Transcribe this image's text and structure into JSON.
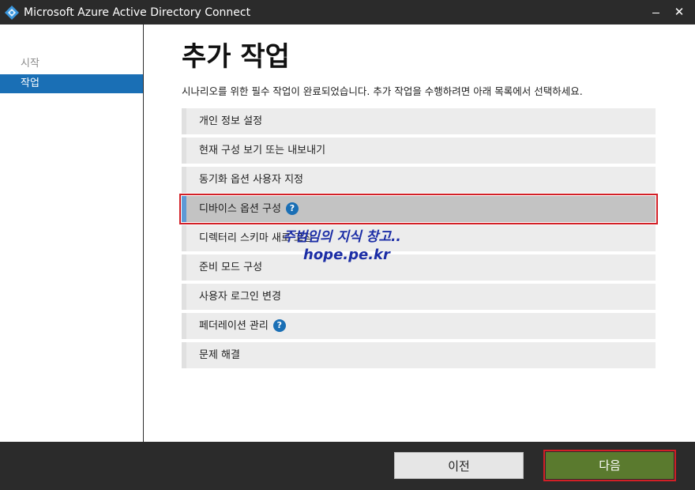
{
  "window": {
    "title": "Microsoft Azure Active Directory Connect",
    "minimize_icon": "minimize-icon",
    "close_label": "✕",
    "logo_icon": "azure-diamond-icon"
  },
  "sidebar": {
    "items": [
      {
        "label": "시작",
        "state": "visited"
      },
      {
        "label": "작업",
        "state": "active"
      }
    ]
  },
  "main": {
    "title": "추가 작업",
    "intro": "시나리오를 위한 필수 작업이 완료되었습니다. 추가 작업을 수행하려면 아래 목록에서 선택하세요.",
    "tasks": [
      {
        "label": "개인 정보 설정",
        "help": false,
        "selected": false
      },
      {
        "label": "현재 구성 보기 또는 내보내기",
        "help": false,
        "selected": false
      },
      {
        "label": "동기화 옵션 사용자 지정",
        "help": false,
        "selected": false
      },
      {
        "label": "디바이스 옵션 구성",
        "help": true,
        "selected": true
      },
      {
        "label": "디렉터리 스키마 새로 고침",
        "help": false,
        "selected": false
      },
      {
        "label": "준비 모드 구성",
        "help": false,
        "selected": false
      },
      {
        "label": "사용자 로그인 변경",
        "help": false,
        "selected": false
      },
      {
        "label": "페더레이션 관리",
        "help": true,
        "selected": false
      },
      {
        "label": "문제 해결",
        "help": false,
        "selected": false
      }
    ],
    "help_symbol": "?"
  },
  "watermark": {
    "line1": "주범임의 지식 창고..",
    "line2": "hope.pe.kr"
  },
  "footer": {
    "previous_label": "이전",
    "next_label": "다음"
  },
  "colors": {
    "titlebar": "#2b2b2b",
    "accent": "#1a6fb5",
    "highlight_border": "#d21f26",
    "next_button": "#5a7a2e",
    "selected_row": "#c3c3c3",
    "watermark": "#1c2ea6"
  }
}
